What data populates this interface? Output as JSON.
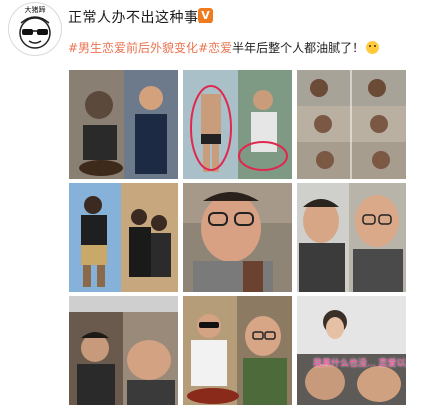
{
  "header": {
    "avatar_caption": "大猪蹄",
    "username": "正常人办不出这种事儿",
    "verified_badge": "V"
  },
  "post": {
    "hashtag_1": "#男生恋爱前后外貌变化",
    "hashtag_2": "#恋爱",
    "text": "半年后整个人都油腻了！",
    "emoji_icon": "grinning-face-emoji"
  },
  "grid": {
    "rows": 3,
    "columns": 3,
    "cells": [
      {
        "name": "photo-1",
        "description_icon": "photo-thumbnail"
      },
      {
        "name": "photo-2",
        "description_icon": "photo-thumbnail"
      },
      {
        "name": "photo-3",
        "description_icon": "photo-thumbnail"
      },
      {
        "name": "photo-4",
        "description_icon": "photo-thumbnail"
      },
      {
        "name": "photo-5",
        "description_icon": "photo-thumbnail"
      },
      {
        "name": "photo-6",
        "description_icon": "photo-thumbnail"
      },
      {
        "name": "photo-7",
        "description_icon": "photo-thumbnail"
      },
      {
        "name": "photo-8",
        "description_icon": "photo-thumbnail"
      },
      {
        "name": "photo-9",
        "description_icon": "photo-thumbnail",
        "overlay_text": "我真什么也没... 恋爱以后就"
      }
    ]
  },
  "colors": {
    "hashtag": "#eb7350",
    "verify_badge": "#f07a1e",
    "text": "#222222"
  }
}
